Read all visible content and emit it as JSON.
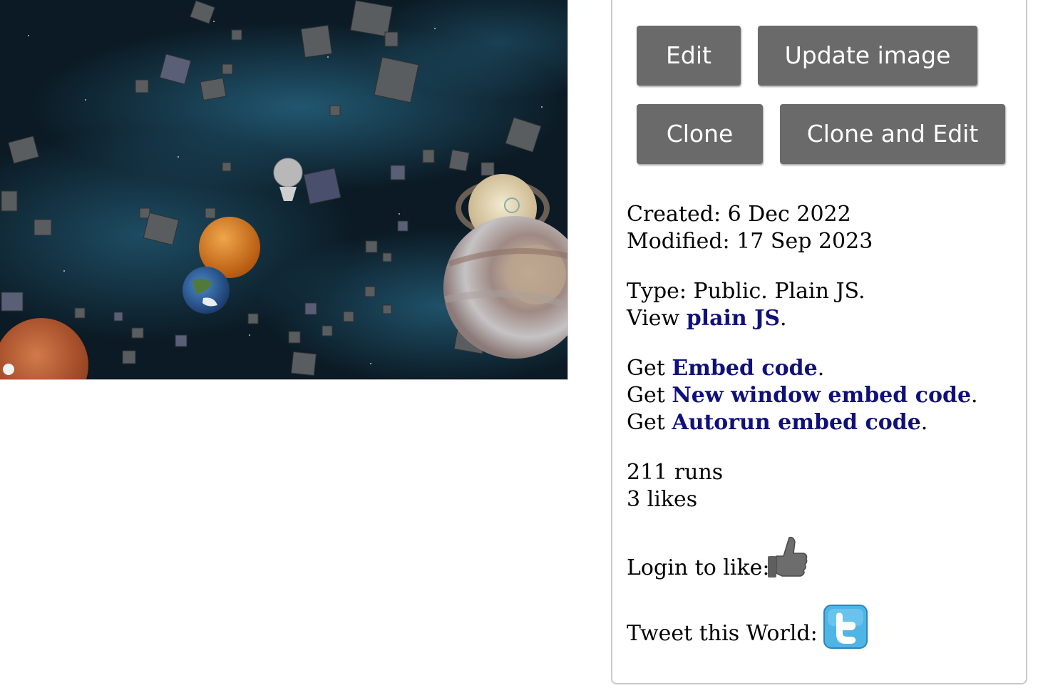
{
  "buttons": {
    "edit": "Edit",
    "update_image": "Update image",
    "clone": "Clone",
    "clone_and_edit": "Clone and Edit"
  },
  "meta": {
    "created_label": "Created:",
    "created": "6 Dec 2022",
    "modified_label": "Modified:",
    "modified": "17 Sep 2023"
  },
  "type": {
    "text": "Type: Public. Plain JS.",
    "view_prefix": "View ",
    "view_link": "plain JS",
    "period": "."
  },
  "embed": {
    "get": "Get ",
    "embed_code": "Embed code",
    "new_window_embed_code": "New window embed code",
    "autorun_embed_code": "Autorun embed code",
    "period": "."
  },
  "stats": {
    "runs": "211 runs",
    "likes": "3 likes"
  },
  "social": {
    "login_to_like": "Login to like:",
    "tweet_this_world": "Tweet this World:",
    "like_icon": "thumbs-up-icon",
    "tweet_icon": "twitter-icon",
    "twitter_color": "#4fb4e6",
    "thumb_color": "#6d6d6d"
  },
  "colors": {
    "button_bg": "#6a6a6a",
    "link": "#10107a",
    "space_dark": "#0b1a24",
    "nebula": "#2a7fa6"
  }
}
